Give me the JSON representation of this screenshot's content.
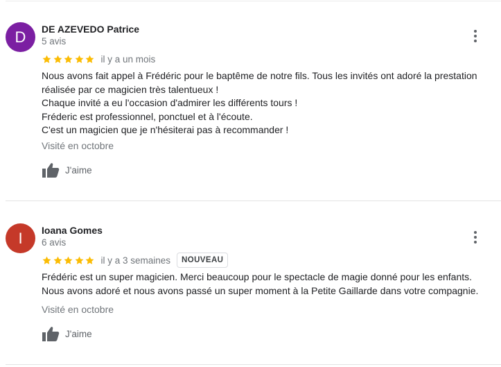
{
  "colors": {
    "star": "#fbbc04",
    "avatar_1": "#7b1fa2",
    "avatar_2": "#c53929",
    "muted_text": "#70757a"
  },
  "reviews": [
    {
      "avatar_letter": "D",
      "name": "DE AZEVEDO Patrice",
      "review_count": "5 avis",
      "rating": 5,
      "date": "il y a un mois",
      "badge": "",
      "lines": [
        "Nous avons fait appel à Frédéric pour le baptême de notre fils. Tous les invités ont adoré la prestation",
        "réalisée par ce magicien très talentueux !",
        "Chaque invité a eu l'occasion d'admirer les différents tours !",
        "Fréderic est professionnel, ponctuel et à l'écoute.",
        "C'est un magicien que je n'hésiterai pas à recommander !"
      ],
      "visited": "Visité en octobre",
      "like_label": "J'aime"
    },
    {
      "avatar_letter": "I",
      "name": "Ioana Gomes",
      "review_count": "6 avis",
      "rating": 5,
      "date": "il y a 3 semaines",
      "badge": "NOUVEAU",
      "lines": [
        "Frédéric est un super magicien. Merci beaucoup pour le spectacle de magie donné pour les enfants.",
        "Nous avons adoré et nous avons passé un super moment à la Petite Gaillarde dans votre compagnie."
      ],
      "visited": "Visité en octobre",
      "like_label": "J'aime"
    }
  ],
  "icons": {
    "more": "more-vert-icon",
    "like": "thumb-up-icon",
    "star": "star-icon"
  }
}
